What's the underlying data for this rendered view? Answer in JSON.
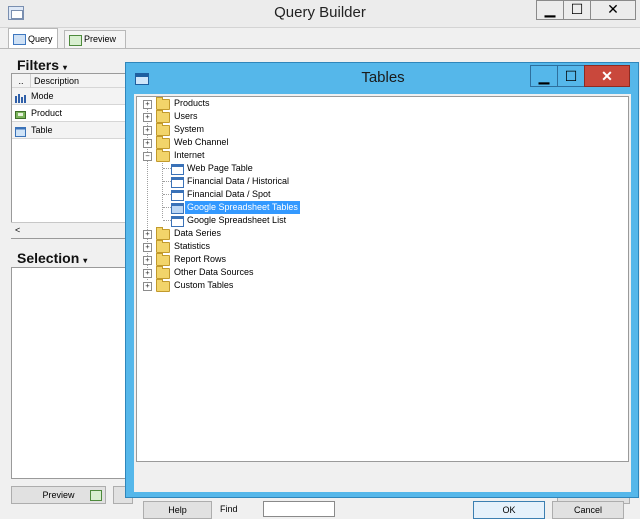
{
  "window": {
    "title": "Query Builder",
    "controls": {
      "minimize": "▁",
      "maximize": "☐",
      "close": "✕"
    }
  },
  "tabs": [
    {
      "label": "Query",
      "icon": "table-icon",
      "selected": true
    },
    {
      "label": "Preview",
      "icon": "preview-grid-icon",
      "selected": false
    }
  ],
  "filters": {
    "heading": "Filters",
    "column_header_marker": "..",
    "column_header": "Description",
    "rows": [
      {
        "label": "Mode",
        "icon": "bar-chart-icon"
      },
      {
        "label": "Product",
        "icon": "product-box-icon"
      },
      {
        "label": "Table",
        "icon": "table-icon"
      }
    ],
    "scroll_left": "<"
  },
  "selection": {
    "heading": "Selection"
  },
  "bottom": {
    "preview_label": "Preview"
  },
  "dialog": {
    "title": "Tables",
    "controls": {
      "minimize": "▁",
      "maximize": "☐",
      "close": "✕"
    },
    "tree": [
      {
        "label": "Products",
        "type": "folder",
        "expander": "+"
      },
      {
        "label": "Users",
        "type": "folder",
        "expander": "+"
      },
      {
        "label": "System",
        "type": "folder",
        "expander": "+"
      },
      {
        "label": "Web Channel",
        "type": "folder",
        "expander": "+"
      },
      {
        "label": "Internet",
        "type": "folder",
        "expander": "−",
        "children": [
          {
            "label": "Web Page Table",
            "type": "table"
          },
          {
            "label": "Financial Data / Historical",
            "type": "table"
          },
          {
            "label": "Financial Data / Spot",
            "type": "table"
          },
          {
            "label": "Google Spreadsheet Tables",
            "type": "table",
            "selected": true
          },
          {
            "label": "Google Spreadsheet List",
            "type": "table"
          }
        ]
      },
      {
        "label": "Data Series",
        "type": "folder",
        "expander": "+"
      },
      {
        "label": "Statistics",
        "type": "folder",
        "expander": "+"
      },
      {
        "label": "Report Rows",
        "type": "folder",
        "expander": "+"
      },
      {
        "label": "Other Data Sources",
        "type": "folder",
        "expander": "+"
      },
      {
        "label": "Custom Tables",
        "type": "folder",
        "expander": "+"
      }
    ],
    "footer": {
      "help_label": "Help",
      "find_label": "Find",
      "find_value": "",
      "ok_label": "OK",
      "cancel_label": "Cancel"
    }
  },
  "colors": {
    "dialog_frame": "#55b7ea",
    "close_button": "#c9483c",
    "selection_highlight": "#3399ff",
    "folder": "#f2d46a"
  }
}
